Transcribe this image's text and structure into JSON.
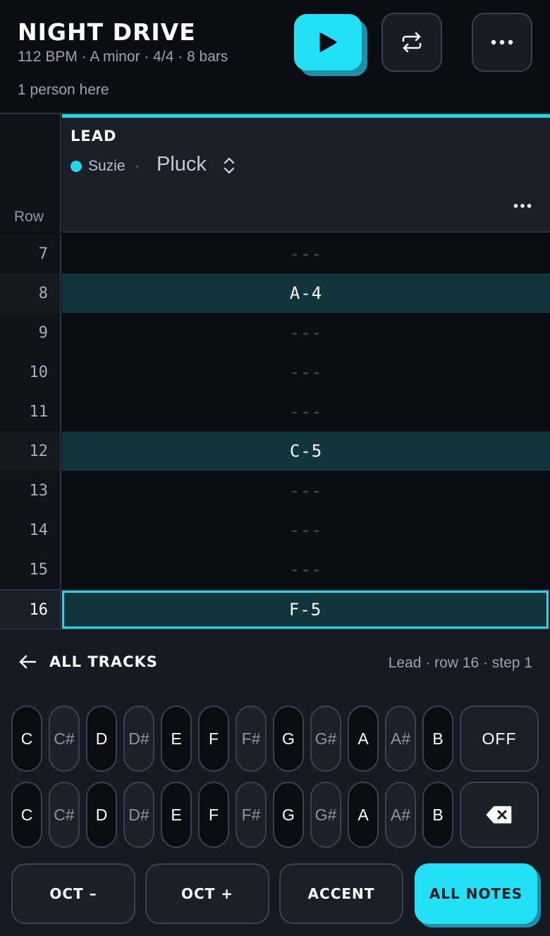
{
  "song": {
    "title": "NIGHT DRIVE",
    "meta": "112 BPM · A minor · 4/4 · 8 bars",
    "presence": "1 person here"
  },
  "header_buttons": {
    "play_icon": "play-icon",
    "loop_icon": "loop-icon",
    "more_icon": "more-icon"
  },
  "grid": {
    "row_header": "Row",
    "track": {
      "name": "LEAD",
      "user": "Suzie",
      "separator": "·",
      "instrument": "Pluck",
      "color": "#22d6ee"
    },
    "rows": [
      {
        "num": "7",
        "value": "---"
      },
      {
        "num": "8",
        "value": "A-4"
      },
      {
        "num": "9",
        "value": "---"
      },
      {
        "num": "10",
        "value": "---"
      },
      {
        "num": "11",
        "value": "---"
      },
      {
        "num": "12",
        "value": "C-5"
      },
      {
        "num": "13",
        "value": "---"
      },
      {
        "num": "14",
        "value": "---"
      },
      {
        "num": "15",
        "value": "---"
      },
      {
        "num": "16",
        "value": "F-5"
      }
    ]
  },
  "panel": {
    "back_label": "ALL TRACKS",
    "status": "Lead · row 16 · step 1",
    "keys_row1": [
      "C",
      "C#",
      "D",
      "D#",
      "E",
      "F",
      "F#",
      "G",
      "G#",
      "A",
      "A#",
      "B"
    ],
    "keys_row2": [
      "C",
      "C#",
      "D",
      "D#",
      "E",
      "F",
      "F#",
      "G",
      "G#",
      "A",
      "A#",
      "B"
    ],
    "off_label": "OFF",
    "backspace_icon": "backspace-icon",
    "actions": {
      "oct_down": "OCT –",
      "oct_up": "OCT +",
      "accent": "ACCENT",
      "all_notes": "ALL NOTES"
    }
  },
  "colors": {
    "accent": "#22e1f6",
    "note_bg": "#12343b",
    "background": "#0b0d12"
  }
}
